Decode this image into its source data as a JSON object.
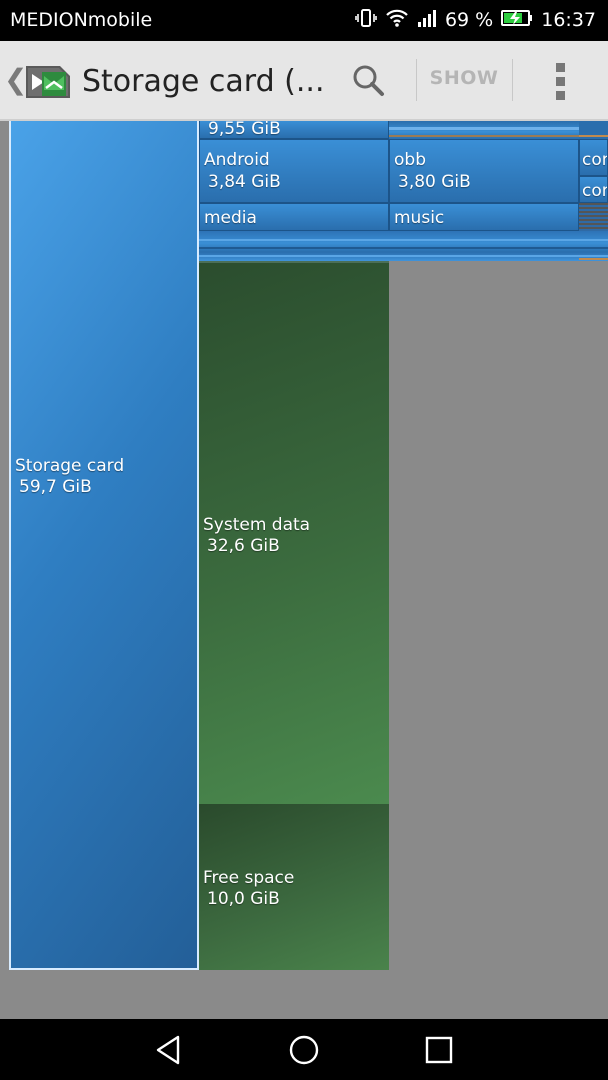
{
  "status_bar": {
    "carrier": "MEDIONmobile",
    "battery": "69 %",
    "time": "16:37",
    "icons": [
      "vibrate-icon",
      "wifi-icon",
      "signal-icon",
      "battery-charging-icon"
    ],
    "battery_color": "#2ecc40"
  },
  "action_bar": {
    "title": "Storage card (...",
    "show_label": "SHOW",
    "icons": [
      "up-chevron-icon",
      "app-logo-icon",
      "search-icon",
      "overflow-menu-icon"
    ]
  },
  "treemap": {
    "root": {
      "name": "Storage card",
      "size": "59,7 GiB"
    },
    "top_partial": {
      "size": "9,55 GiB"
    },
    "android": {
      "name": "Android",
      "size": "3,84 GiB"
    },
    "obb": {
      "name": "obb",
      "size": "3,80 GiB"
    },
    "com1": {
      "name": "cor"
    },
    "com2": {
      "name": "cor"
    },
    "media": {
      "name": "media"
    },
    "music": {
      "name": "music"
    },
    "system": {
      "name": "System data",
      "size": "32,6 GiB"
    },
    "free": {
      "name": "Free space",
      "size": "10,0 GiB"
    },
    "colors": {
      "folder_blue": "#2f7ec2",
      "system_green": "#3b6b3e",
      "background": "#8a8a8a"
    }
  },
  "nav_bar": {
    "icons": [
      "back-icon",
      "home-icon",
      "recents-icon"
    ]
  }
}
